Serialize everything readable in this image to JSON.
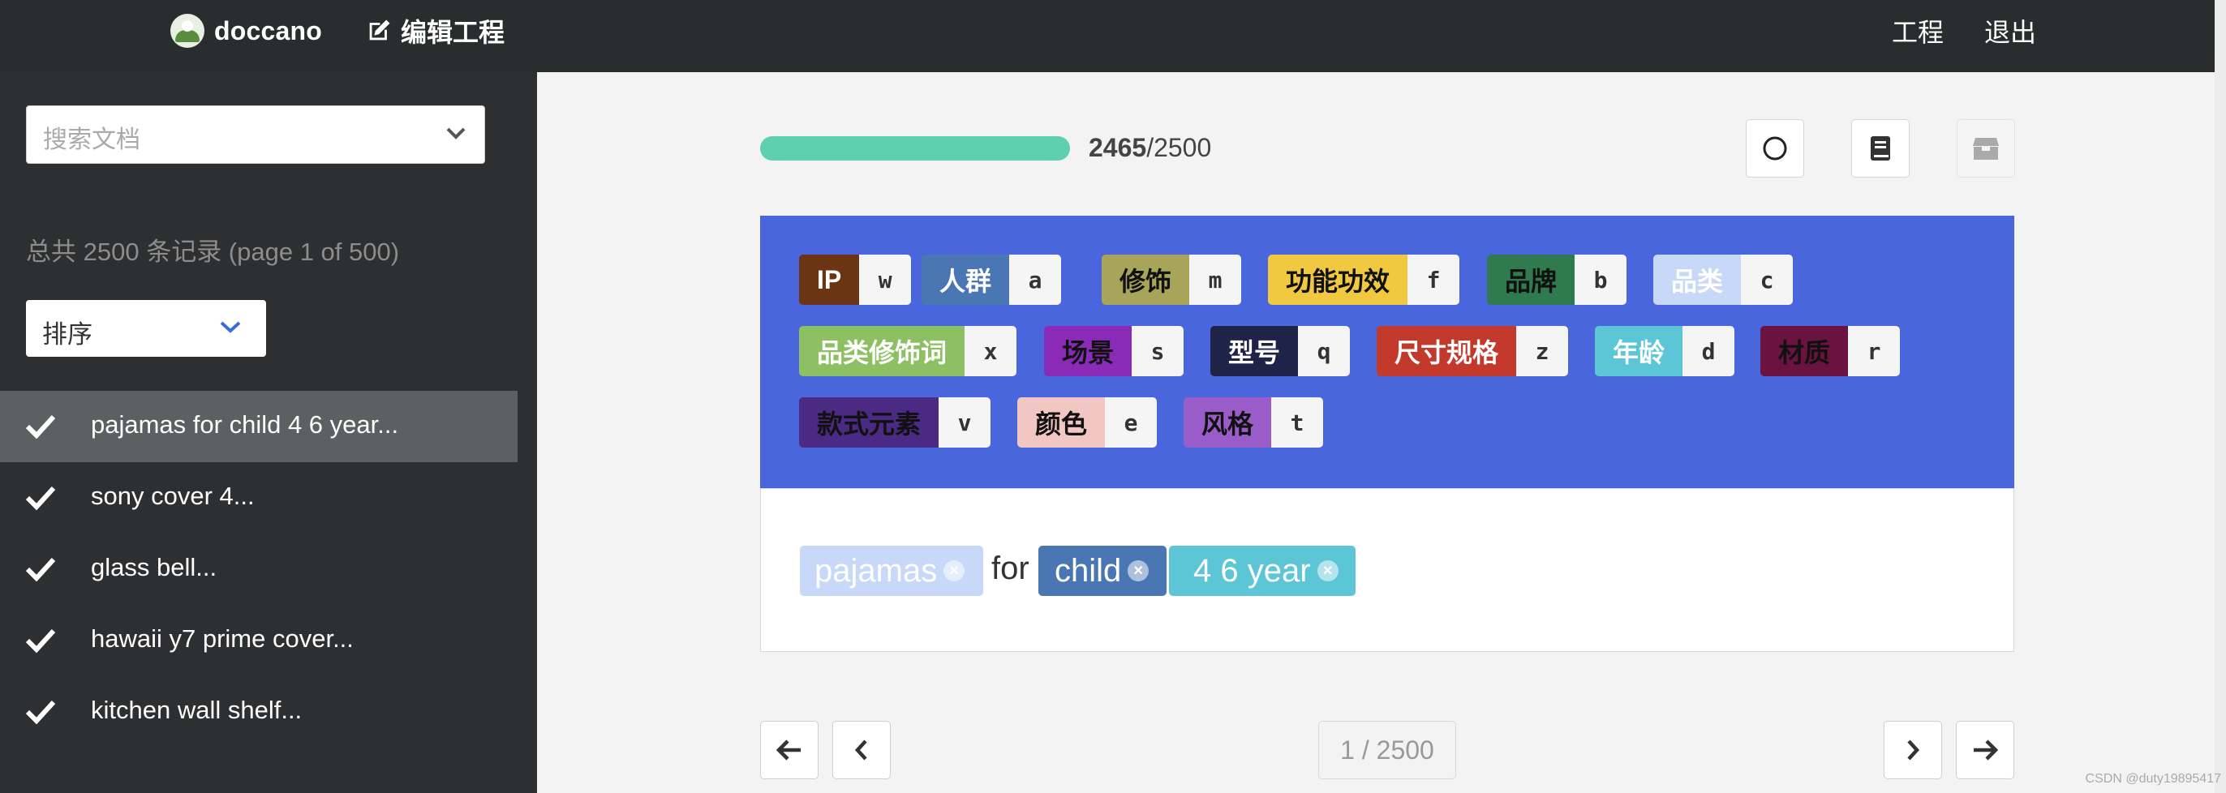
{
  "navbar": {
    "brand": "doccano",
    "edit_project": "编辑工程",
    "projects": "工程",
    "logout": "退出"
  },
  "sidebar": {
    "search_placeholder": "搜索文档",
    "summary": "总共 2500 条记录 (page 1 of 500)",
    "sort_label": "排序",
    "documents": [
      {
        "text": "pajamas for child 4 6 year...",
        "done": true,
        "active": true
      },
      {
        "text": "sony cover 4...",
        "done": true,
        "active": false
      },
      {
        "text": "glass bell...",
        "done": true,
        "active": false
      },
      {
        "text": "hawaii y7 prime cover...",
        "done": true,
        "active": false
      },
      {
        "text": "kitchen wall shelf...",
        "done": true,
        "active": false
      }
    ]
  },
  "progress": {
    "done": "2465",
    "total": "/2500",
    "fraction": 0.986
  },
  "toolbar_icons": [
    "circle-icon",
    "book-icon",
    "archive-icon"
  ],
  "labels": [
    {
      "name": "IP",
      "key": "w",
      "bg": "#6b3413",
      "fg": "#ffffff"
    },
    {
      "name": "人群",
      "key": "a",
      "bg": "#4a77b4",
      "fg": "#ffffff"
    },
    {
      "name": "修饰",
      "key": "m",
      "bg": "#a8a45a",
      "fg": "#111111"
    },
    {
      "name": "功能功效",
      "key": "f",
      "bg": "#f0c940",
      "fg": "#111111"
    },
    {
      "name": "品牌",
      "key": "b",
      "bg": "#2f7a4e",
      "fg": "#111111"
    },
    {
      "name": "品类",
      "key": "c",
      "bg": "#c7d8f8",
      "fg": "#ffffff"
    },
    {
      "name": "品类修饰词",
      "key": "x",
      "bg": "#8cc063",
      "fg": "#ffffff"
    },
    {
      "name": "场景",
      "key": "s",
      "bg": "#8a2bb8",
      "fg": "#111111"
    },
    {
      "name": "型号",
      "key": "q",
      "bg": "#1e2347",
      "fg": "#ffffff"
    },
    {
      "name": "尺寸规格",
      "key": "z",
      "bg": "#c33a2c",
      "fg": "#ffffff"
    },
    {
      "name": "年龄",
      "key": "d",
      "bg": "#5cc6d6",
      "fg": "#ffffff"
    },
    {
      "name": "材质",
      "key": "r",
      "bg": "#6a1240",
      "fg": "#111111"
    },
    {
      "name": "款式元素",
      "key": "v",
      "bg": "#4a2a82",
      "fg": "#111111"
    },
    {
      "name": "颜色",
      "key": "e",
      "bg": "#f2c6c2",
      "fg": "#111111"
    },
    {
      "name": "风格",
      "key": "t",
      "bg": "#9a5cc8",
      "fg": "#111111"
    }
  ],
  "annotation": {
    "entities": [
      {
        "text": "pajamas",
        "bg": "#c7d8f8",
        "fg": "#ffffff"
      },
      {
        "text": "child",
        "bg": "#4a77b4",
        "fg": "#ffffff"
      },
      {
        "text": "4 6 year",
        "bg": "#5cc6d6",
        "fg": "#ffffff"
      }
    ],
    "plain_for": "for"
  },
  "pagination": {
    "indicator": "1 / 2500"
  },
  "watermark": "CSDN @duty19895417"
}
